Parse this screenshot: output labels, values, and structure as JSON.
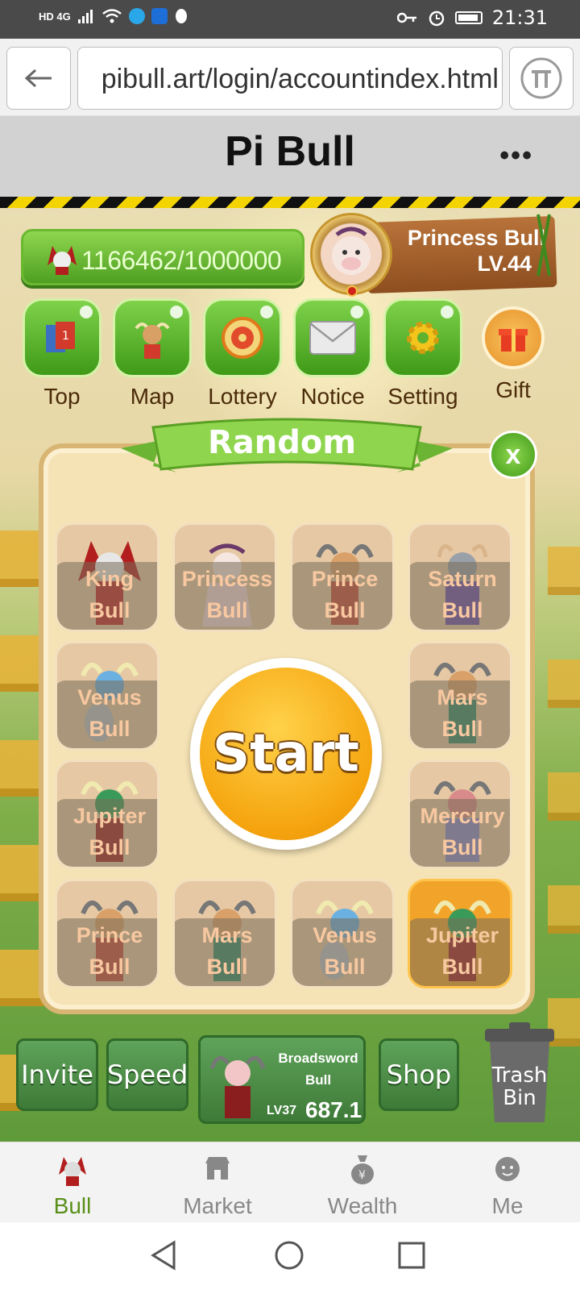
{
  "status_bar": {
    "signal_text": "HD 4G",
    "time": "21:31"
  },
  "browser": {
    "url": "pibull.art/login/accountindex.html"
  },
  "header": {
    "title": "Pi Bull",
    "more": "•••"
  },
  "game": {
    "balance": "1166462/1000000",
    "profile": {
      "name": "Princess Bull",
      "level": "LV.44"
    },
    "menu": [
      {
        "label": "Top",
        "icon": "trophy-book-icon"
      },
      {
        "label": "Map",
        "icon": "bull-map-icon"
      },
      {
        "label": "Lottery",
        "icon": "wheel-icon"
      },
      {
        "label": "Notice",
        "icon": "envelope-icon"
      },
      {
        "label": "Setting",
        "icon": "gear-icon"
      },
      {
        "label": "Gift",
        "icon": "gift-icon"
      }
    ],
    "random_modal": {
      "title": "Random",
      "close": "x",
      "start_label": "Start",
      "cards": [
        {
          "line1": "King",
          "line2": "Bull"
        },
        {
          "line1": "Princess",
          "line2": "Bull"
        },
        {
          "line1": "Prince",
          "line2": "Bull"
        },
        {
          "line1": "Saturn",
          "line2": "Bull"
        },
        {
          "line1": "Venus",
          "line2": "Bull"
        },
        {
          "line1": "Mars",
          "line2": "Bull"
        },
        {
          "line1": "Jupiter",
          "line2": "Bull"
        },
        {
          "line1": "Mercury",
          "line2": "Bull"
        },
        {
          "line1": "Prince",
          "line2": "Bull"
        },
        {
          "line1": "Mars",
          "line2": "Bull"
        },
        {
          "line1": "Venus",
          "line2": "Bull"
        },
        {
          "line1": "Jupiter",
          "line2": "Bull"
        }
      ],
      "selected_card": "Jupiter Bull"
    },
    "bottom_buttons": {
      "invite": "Invite",
      "speed": "Speed",
      "current_bull_line1": "Broadsword",
      "current_bull_line2": "Bull",
      "current_bull_level": "LV37",
      "current_bull_power": "687.1",
      "shop": "Shop",
      "trash_line1": "Trash",
      "trash_line2": "Bin"
    }
  },
  "tabbar": [
    {
      "label": "Bull",
      "active": true
    },
    {
      "label": "Market",
      "active": false
    },
    {
      "label": "Wealth",
      "active": false
    },
    {
      "label": "Me",
      "active": false
    }
  ],
  "colors": {
    "accent_green": "#5a8f1a",
    "button_green": "#4e9f22",
    "start_orange": "#f5a40e",
    "hazard_yellow": "#f4d400"
  }
}
